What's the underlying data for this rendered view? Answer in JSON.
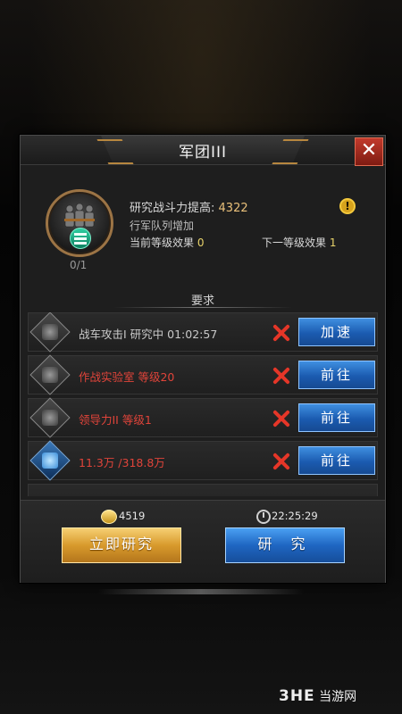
{
  "dialog": {
    "title": "军团III"
  },
  "tech": {
    "level_count": "0/1",
    "power_label": "研究战斗力提高:",
    "power_value": "4322",
    "description": "行军队列增加",
    "current_label": "当前等级效果",
    "current_value": "0",
    "next_label": "下一等级效果",
    "next_value": "1"
  },
  "requirements": {
    "header": "要求",
    "items": [
      {
        "text": "战车攻击I 研究中 01:02:57",
        "status": "in-progress",
        "button": "加速",
        "icon": "tank-icon"
      },
      {
        "text": "作战实验室 等级20",
        "status": "unmet",
        "button": "前往",
        "icon": "lab-building-icon"
      },
      {
        "text": "领导力II 等级1",
        "status": "unmet",
        "button": "前往",
        "icon": "troops-icon"
      },
      {
        "text": "11.3万 /318.8万",
        "status": "unmet",
        "button": "前往",
        "icon": "crystal-icon"
      }
    ]
  },
  "footer": {
    "gold_amount": "4519",
    "time": "22:25:29",
    "instant_button": "立即研究",
    "research_button": "研 究"
  },
  "watermark": {
    "logo": "3HE",
    "site": "当游网"
  },
  "colors": {
    "gold_button": "#d89a2c",
    "blue_button": "#1f66c2",
    "error_red": "#e0443a",
    "accent_bronze": "#b7873f"
  }
}
